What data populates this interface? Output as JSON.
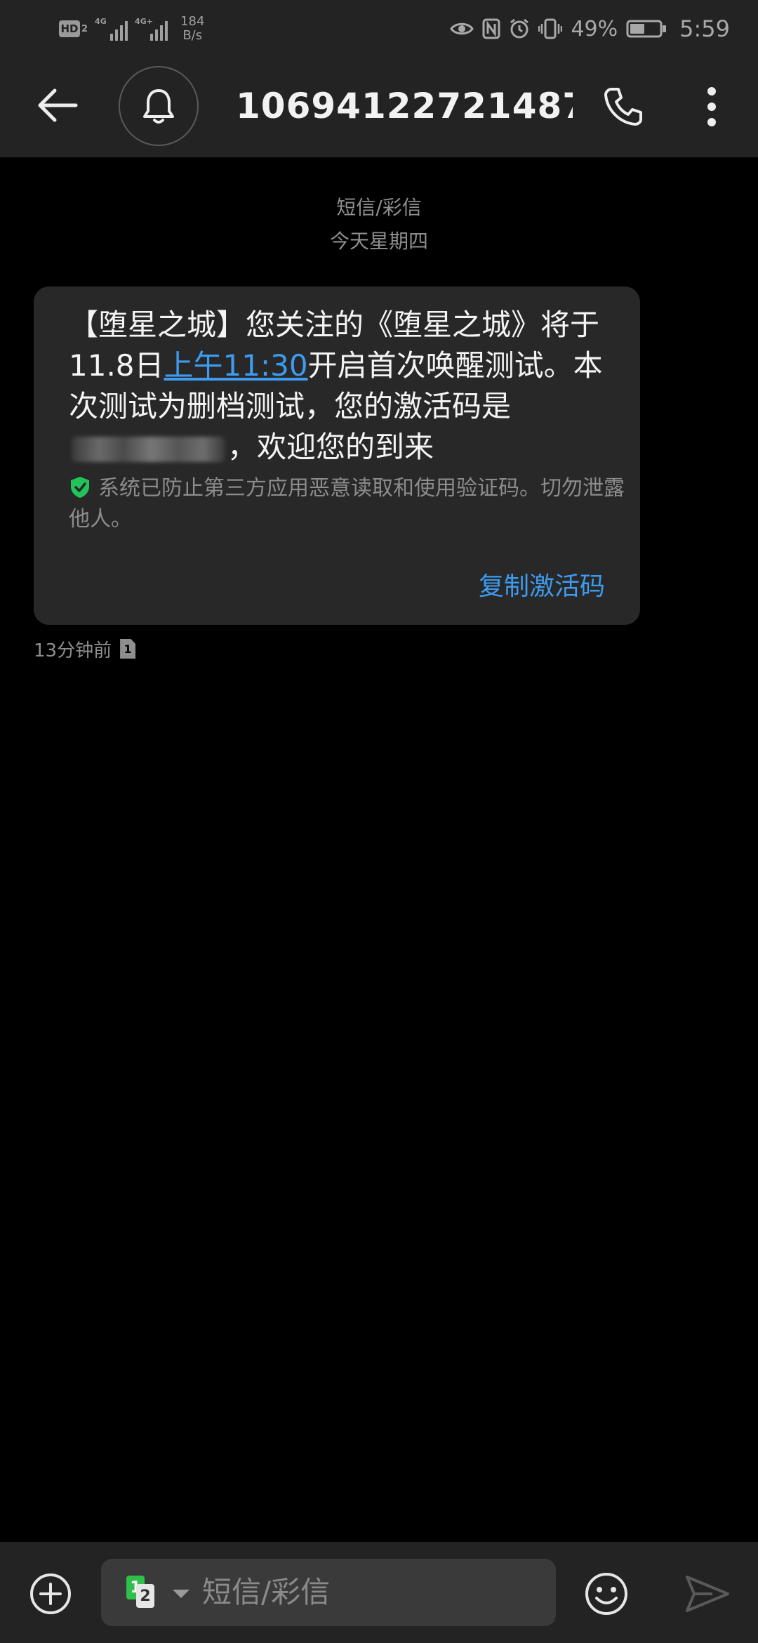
{
  "status_bar": {
    "hd_label": "HD",
    "hd_sub": "2",
    "net1": "4G",
    "net2": "4G+",
    "speed_value": "184",
    "speed_unit": "B/s",
    "battery": "49%",
    "time": "5:59"
  },
  "header": {
    "title": "10694122721487..."
  },
  "conversation": {
    "type_label": "短信/彩信",
    "date_label": "今天星期四"
  },
  "message": {
    "text_before_link": "【堕星之城】您关注的《堕星之城》将于11.8日",
    "link_text": "上午11:30",
    "text_after_link": "开启首次唤醒测试。本次测试为删档测试，您的激活码是",
    "text_end": "，欢迎您的到来",
    "security_note": "系统已防止第三方应用恶意读取和使用验证码。切勿泄露他人。",
    "copy_button": "复制激活码",
    "time_ago": "13分钟前",
    "sim_indicator": "1"
  },
  "input": {
    "sim1": "1",
    "sim2": "2",
    "placeholder": "短信/彩信"
  },
  "colors": {
    "background": "#000000",
    "bar": "#232323",
    "bubble": "#282828",
    "link": "#3d9bf0",
    "sim_green": "#2fbf4a",
    "shield_green": "#22c35a"
  }
}
